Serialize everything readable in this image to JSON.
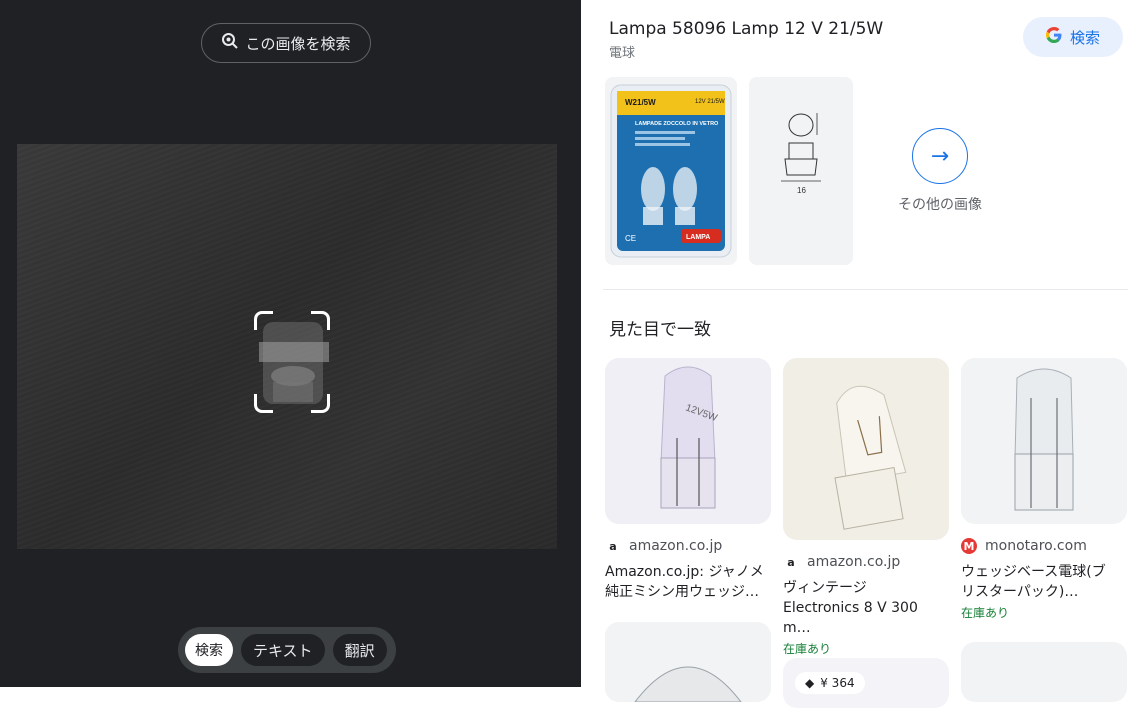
{
  "left": {
    "search_image_label": "この画像を検索",
    "modes": [
      "検索",
      "テキスト",
      "翻訳"
    ]
  },
  "right": {
    "title": "Lampa 58096 Lamp 12 V 21/5W",
    "subtitle": "電球",
    "google_search_label": "検索",
    "more_images_label": "その他の画像",
    "package": {
      "label_top": "W21/5W",
      "label_spec": "12V 21/5W",
      "heading": "LAMPADE ZOCCOLO IN VETRO",
      "brand": "LAMPA",
      "ce": "CE"
    },
    "diagram_dim": "16",
    "visual_matches_title": "見た目で一致",
    "results": [
      {
        "source": "amazon.co.jp",
        "title_line1": "Amazon.co.jp: ジャノメ",
        "title_line2": "純正ミシン用ウェッジ…",
        "stock": ""
      },
      {
        "source": "amazon.co.jp",
        "title_line1": "ヴィンテージ",
        "title_line2": "Electronics 8 V 300 m…",
        "stock": "在庫あり"
      },
      {
        "source": "monotaro.com",
        "title_line1": "ウェッジベース電球(ブ",
        "title_line2": "リスターパック)…",
        "stock": "在庫あり"
      }
    ],
    "partial_price": "¥ 364"
  },
  "colors": {
    "accent": "#1a73e8",
    "stock": "#188038",
    "dark_bg": "#202124"
  }
}
